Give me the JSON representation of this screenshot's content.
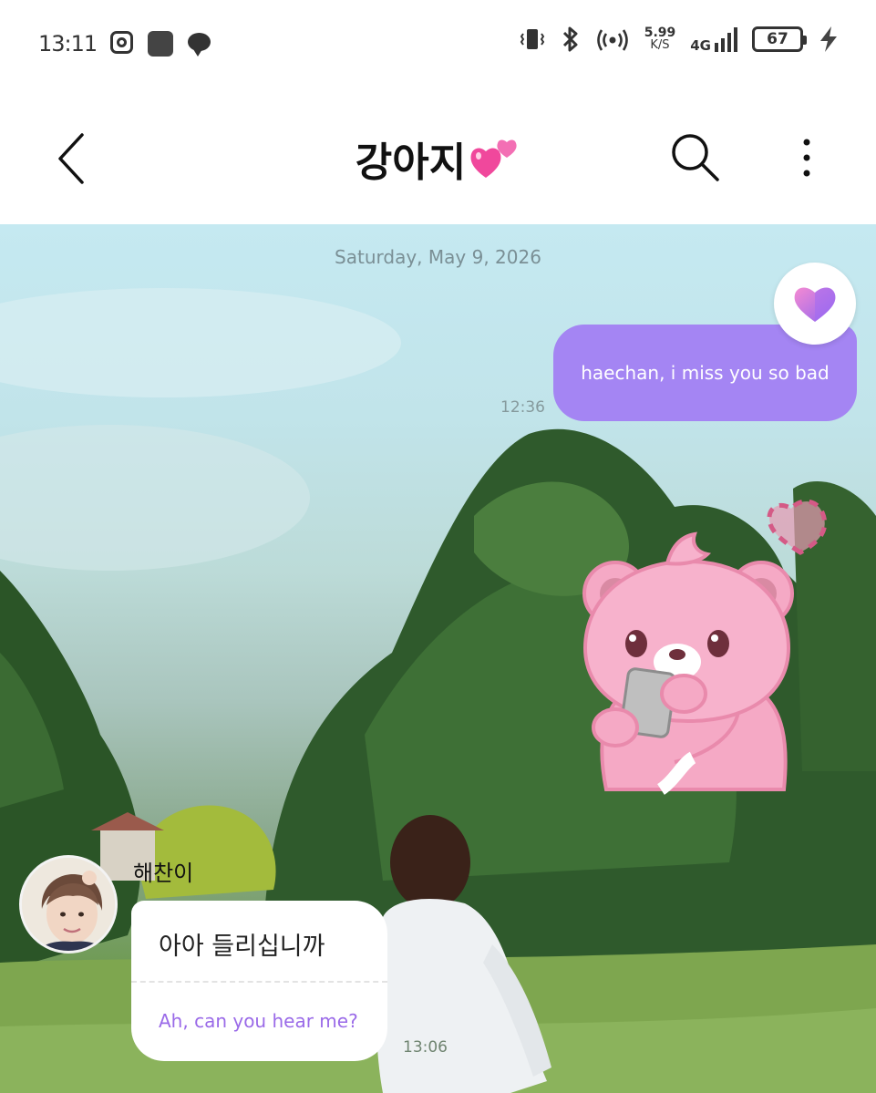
{
  "status_bar": {
    "time": "13:11",
    "net_speed_value": "5.99",
    "net_speed_unit": "K/S",
    "network_type": "4G",
    "battery": "67",
    "icons": [
      "instagram-icon",
      "app-icon",
      "talk-icon",
      "vibrate-icon",
      "bluetooth-icon",
      "hotspot-icon",
      "signal-icon",
      "battery-icon",
      "charging-icon"
    ]
  },
  "header": {
    "title": "강아지",
    "title_emoji": "two-hearts",
    "back_icon": "chevron-left-icon",
    "search_icon": "search-icon",
    "more_icon": "more-vertical-icon"
  },
  "chat": {
    "date": "Saturday, May 9, 2026",
    "messages": [
      {
        "direction": "outgoing",
        "text": "haechan, i miss you so bad",
        "time": "12:36",
        "reaction": "heart"
      },
      {
        "direction": "outgoing",
        "type": "sticker",
        "sticker": "pink-bear-holding-phone"
      },
      {
        "direction": "incoming",
        "sender": "해찬이",
        "text": "아아 들리십니까",
        "translation": "Ah, can you hear me?",
        "time": "13:06"
      }
    ]
  },
  "colors": {
    "outgoing_bubble": "#a485f3",
    "translation_text": "#9a6ae8",
    "reaction_heart": "#c77df0"
  }
}
